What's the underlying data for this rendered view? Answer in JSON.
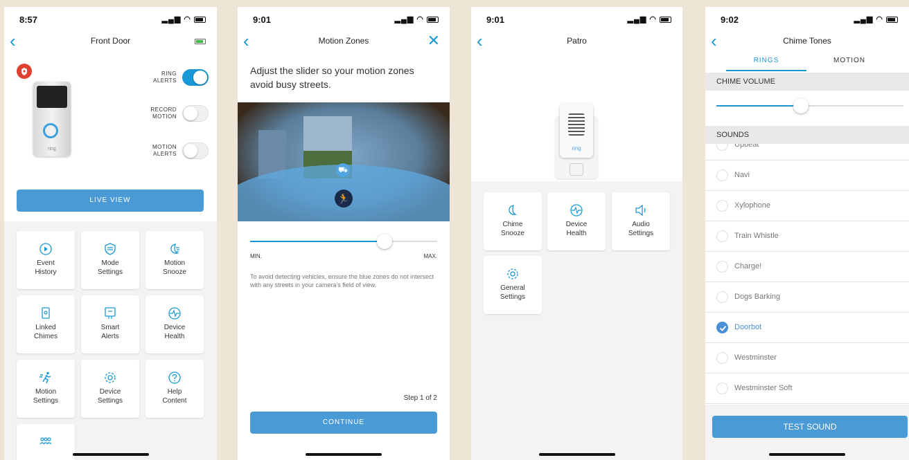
{
  "screens": {
    "front_door": {
      "time": "8:57",
      "title": "Front Door",
      "ring_alerts": "RING\nALERTS",
      "record_motion": "RECORD\nMOTION",
      "motion_alerts": "MOTION\nALERTS",
      "doorbell_brand": "ring",
      "live_view": "LIVE VIEW",
      "tiles": [
        {
          "label": "Event\nHistory",
          "icon": "play-history-icon"
        },
        {
          "label": "Mode\nSettings",
          "icon": "mode-shield-icon"
        },
        {
          "label": "Motion\nSnooze",
          "icon": "moon-lines-icon"
        },
        {
          "label": "Linked\nChimes",
          "icon": "chime-icon"
        },
        {
          "label": "Smart\nAlerts",
          "icon": "smart-alert-icon"
        },
        {
          "label": "Device\nHealth",
          "icon": "pulse-icon"
        },
        {
          "label": "Motion\nSettings",
          "icon": "runner-icon"
        },
        {
          "label": "Device\nSettings",
          "icon": "gear-icon"
        },
        {
          "label": "Help\nContent",
          "icon": "help-icon"
        }
      ]
    },
    "motion_zones": {
      "time": "9:01",
      "title": "Motion Zones",
      "heading": "Adjust the slider so your motion zones avoid busy streets.",
      "slider_min": "MIN.",
      "slider_max": "MAX.",
      "slider_value": 0.72,
      "help_text": "To avoid detecting vehicles,  ensure the blue zones do not intersect with any streets in your camera's field of view.",
      "step": "Step 1 of 2",
      "continue": "CONTINUE"
    },
    "patro": {
      "time": "9:01",
      "title": "Patro",
      "chime_brand": "ring",
      "tiles": [
        {
          "label": "Chime\nSnooze",
          "icon": "moon-icon"
        },
        {
          "label": "Device\nHealth",
          "icon": "pulse-icon"
        },
        {
          "label": "Audio\nSettings",
          "icon": "speaker-icon"
        },
        {
          "label": "General\nSettings",
          "icon": "gear-icon"
        }
      ]
    },
    "chime_tones": {
      "time": "9:02",
      "title": "Chime Tones",
      "tab_rings": "RINGS",
      "tab_motion": "MOTION",
      "chime_volume": "CHIME VOLUME",
      "volume_value": 0.45,
      "sounds": "SOUNDS",
      "items": [
        "Upbeat",
        "Navi",
        "Xylophone",
        "Train Whistle",
        "Charge!",
        "Dogs Barking",
        "Doorbot",
        "Westminster",
        "Westminster Soft"
      ],
      "selected": "Doorbot",
      "test_sound": "TEST SOUND"
    }
  },
  "colors": {
    "accent": "#1998d5",
    "button": "#4a9ad6",
    "record_red": "#e04030",
    "background": "#efe5d6"
  }
}
